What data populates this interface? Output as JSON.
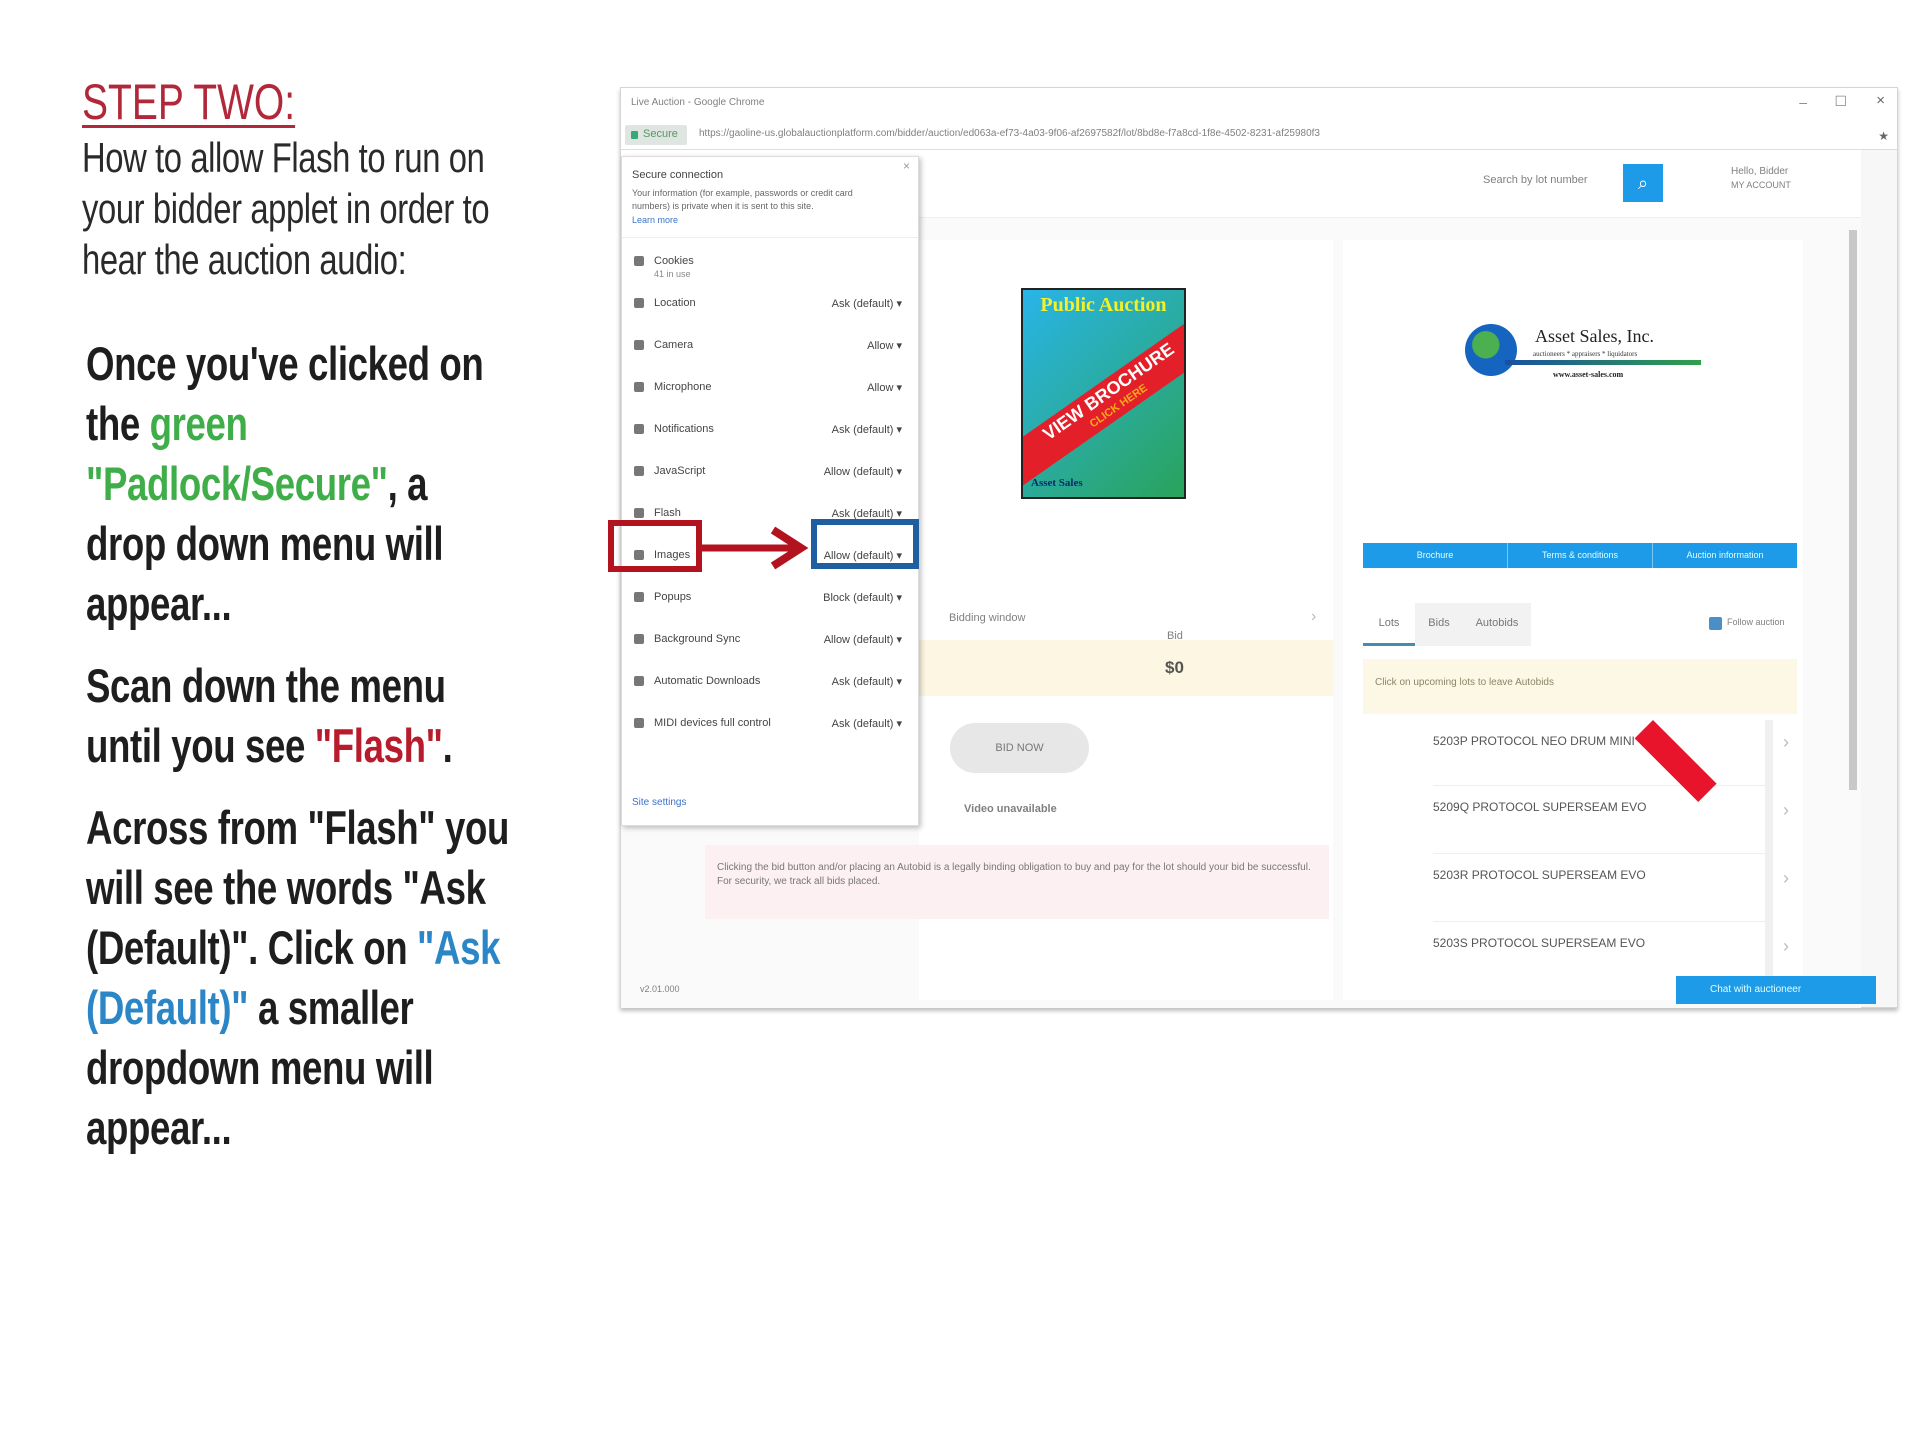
{
  "slide": {
    "heading": "STEP TWO:",
    "subtitle_lines": [
      "How to allow Flash to run on",
      "your bidder applet in order to",
      "hear the auction audio:"
    ],
    "p1": {
      "l1": "Once you've clicked on",
      "l2a": "the ",
      "l2b": "green",
      "l3a": "\"Padlock/Secure\"",
      "l3b": ", a",
      "l4": "drop down menu will",
      "l5": "appear..."
    },
    "p2": {
      "l1": "Scan down the menu",
      "l2a": "until you see ",
      "l2b": "\"Flash\"",
      "l2c": "."
    },
    "p3": {
      "l1": "Across from \"Flash\" you",
      "l2": "will see the words \"Ask",
      "l3a": "(Default)\". Click on ",
      "l3b": "\"Ask",
      "l4a": "(Default)\"",
      "l4b": " a smaller",
      "l5": "dropdown menu will",
      "l6": "appear..."
    },
    "colors": {
      "heading": "#b0283a",
      "green": "#3fae49",
      "red": "#b71c2c",
      "blue": "#2a86c6",
      "highlight_red_box": "#b3121f",
      "highlight_blue_box": "#1f5fa0"
    }
  },
  "browser": {
    "title": "Live Auction - Google Chrome",
    "secure_label": "Secure",
    "url": "https://gaoline-us.globalauctionplatform.com/bidder/auction/ed063a-ef73-4a03-9f06-af2697582f/lot/8bd8e-f7a8cd-1f8e-4502-8231-af25980f3",
    "site_info": {
      "heading": "Secure connection",
      "description": "Your information (for example, passwords or credit card numbers) is private when it is sent to this site.",
      "learn_more": "Learn more",
      "cookies_label": "Cookies",
      "cookies_sub": "41 in use",
      "permissions": [
        {
          "label": "Location",
          "value": "Ask (default)"
        },
        {
          "label": "Camera",
          "value": "Allow"
        },
        {
          "label": "Microphone",
          "value": "Allow"
        },
        {
          "label": "Notifications",
          "value": "Ask (default)"
        },
        {
          "label": "JavaScript",
          "value": "Allow (default)"
        },
        {
          "label": "Flash",
          "value": "Ask (default)"
        },
        {
          "label": "Images",
          "value": "Allow (default)"
        },
        {
          "label": "Popups",
          "value": "Block (default)"
        },
        {
          "label": "Background Sync",
          "value": "Allow (default)"
        },
        {
          "label": "Automatic Downloads",
          "value": "Ask (default)"
        },
        {
          "label": "MIDI devices full control",
          "value": "Ask (default)"
        }
      ],
      "site_settings": "Site settings"
    },
    "page": {
      "search_placeholder": "Search by lot number",
      "user_line1": "Hello, Bidder",
      "user_line2": "MY ACCOUNT",
      "brochure": {
        "title": "Public Auction",
        "banner": "VIEW BROCHURE",
        "banner_sub": "CLICK HERE",
        "footer": "Asset Sales"
      },
      "logo": {
        "name": "Asset Sales, Inc.",
        "tagline": "auctioneers * appraisers * liquidators",
        "url": "www.asset-sales.com"
      },
      "bidding_label": "Bidding window",
      "bid_label": "Bid",
      "bid_amount": "$0",
      "bid_button": "BID NOW",
      "video_status": "Video unavailable",
      "legal_notice": "Clicking the bid button and/or placing an Autobid is a legally binding obligation to buy and pay for the lot should your bid be successful. For security, we track all bids placed.",
      "version": "v2.01.000",
      "action_buttons": [
        "Brochure",
        "Terms & conditions",
        "Auction information"
      ],
      "tabs": [
        "Lots",
        "Bids",
        "Autobids"
      ],
      "follow_label": "Follow auction",
      "notice": "Click on upcoming lots to leave Autobids",
      "lots": [
        "5203P PROTOCOL NEO DRUM MINI",
        "5209Q PROTOCOL SUPERSEAM EVO",
        "5203R PROTOCOL SUPERSEAM EVO",
        "5203S PROTOCOL SUPERSEAM EVO"
      ],
      "chat_button": "Chat with auctioneer"
    }
  }
}
